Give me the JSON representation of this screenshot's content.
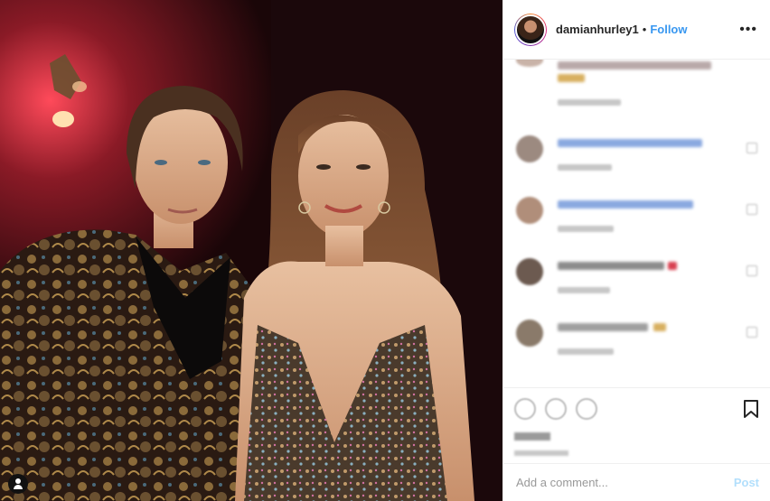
{
  "header": {
    "username": "damianhurley1",
    "separator": "•",
    "follow_label": "Follow",
    "more_icon": "more-options-icon"
  },
  "photo": {
    "tag_icon": "user-tag-icon"
  },
  "comments": [
    {
      "avatar_color": "#c9b3a8",
      "line_color": "#b9a9a9"
    },
    {
      "avatar_color": "#9c8a80",
      "line_color": "#8aa9e0"
    },
    {
      "avatar_color": "#b08e7a",
      "line_color": "#8aa9e0"
    },
    {
      "avatar_color": "#6c5a50",
      "line_color": "#8c8c8c"
    },
    {
      "avatar_color": "#8a7a6a",
      "line_color": "#9f9f9f"
    }
  ],
  "actions": {
    "like_icon": "heart-icon",
    "comment_icon": "comment-icon",
    "share_icon": "share-icon",
    "save_icon": "bookmark-icon"
  },
  "add_comment": {
    "placeholder": "Add a comment...",
    "post_label": "Post"
  }
}
